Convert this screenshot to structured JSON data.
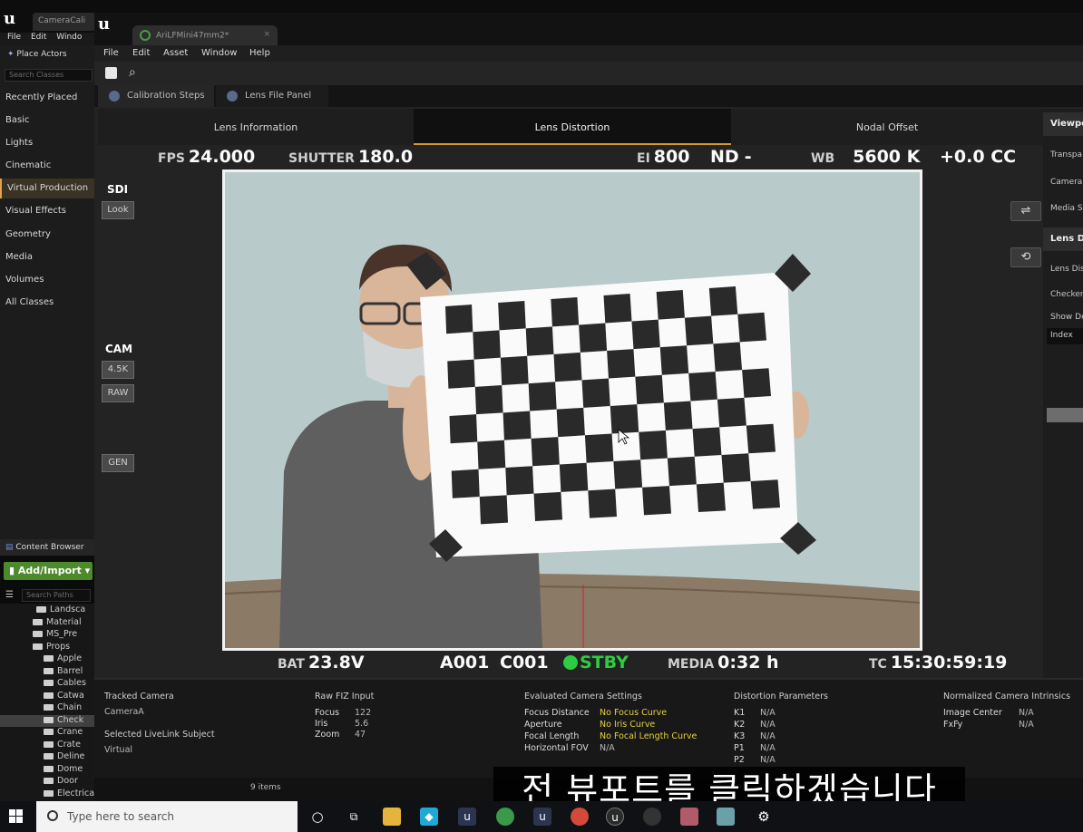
{
  "back_window": {
    "tab_title": "CameraCali",
    "menu": [
      "File",
      "Edit",
      "Windo"
    ],
    "place_actors": "Place Actors",
    "search_classes_placeholder": "Search Classes",
    "categories": [
      "Recently Placed",
      "Basic",
      "Lights",
      "Cinematic",
      "Virtual Production",
      "Visual Effects",
      "Geometry",
      "Media",
      "Volumes",
      "All Classes"
    ],
    "active_category": "Virtual Production",
    "content_browser": "Content Browser",
    "add_import": "Add/Import ▾",
    "search_paths_placeholder": "Search Paths",
    "folders": [
      "Landsca",
      "Material",
      "MS_Pre",
      "Props",
      "Apple",
      "Barrel",
      "Cables",
      "Catwa",
      "Chain",
      "Check",
      "Crane",
      "Crate",
      "Deline",
      "Dome",
      "Door",
      "ElectricalBox"
    ],
    "selected_folder": "Check",
    "items_count": "9 items"
  },
  "front_window": {
    "tab_title": "AriLFMini47mm2*",
    "menu": [
      "File",
      "Edit",
      "Asset",
      "Window",
      "Help"
    ],
    "subtabs": [
      "Calibration Steps",
      "Lens File Panel"
    ],
    "steps": [
      "Lens Information",
      "Lens Distortion",
      "Nodal Offset"
    ],
    "active_step": "Lens Distortion",
    "side_panel": {
      "viewport_head": "Viewpo",
      "items1": [
        "Transpa",
        "Camera",
        "Media S"
      ],
      "lens_head": "Lens Di",
      "items2": [
        "Lens Dis",
        "Checker",
        "Show De"
      ],
      "index_label": "Index"
    }
  },
  "camera_overlay": {
    "fps_label": "FPS",
    "fps_value": "24.000",
    "shutter_label": "SHUTTER",
    "shutter_value": "180.0",
    "ei_label": "EI",
    "ei_value": "800",
    "nd_label": "ND",
    "nd_value": "-",
    "wb_label": "WB",
    "wb_value": "5600 K",
    "cc_value": "+0.0 CC",
    "sdi_label": "SDI",
    "look_btn": "Look",
    "cam_label": "CAM",
    "res_btn": "4.5K",
    "raw_btn": "RAW",
    "gen_btn": "GEN",
    "bat_label": "BAT",
    "bat_value": "23.8V",
    "reel": "A001",
    "clip": "C001",
    "status": "STBY",
    "media_label": "MEDIA",
    "media_value": "0:32 h",
    "tc_label": "TC",
    "tc_value": "15:30:59:19",
    "status_color": "#2ecc40"
  },
  "info": {
    "tracked_camera_h": "Tracked Camera",
    "tracked_camera_v": "CameraA",
    "selected_subject_h": "Selected LiveLink Subject",
    "selected_subject_v": "Virtual",
    "raw_fiz_h": "Raw FIZ Input",
    "fiz": [
      {
        "k": "Focus",
        "v": "122"
      },
      {
        "k": "Iris",
        "v": "5.6"
      },
      {
        "k": "Zoom",
        "v": "47"
      }
    ],
    "evaluated_h": "Evaluated Camera Settings",
    "evaluated": [
      {
        "k": "Focus Distance",
        "v": "No Focus Curve"
      },
      {
        "k": "Aperture",
        "v": "No Iris Curve"
      },
      {
        "k": "Focal Length",
        "v": "No Focal Length Curve"
      },
      {
        "k": "Horizontal FOV",
        "v": "N/A"
      }
    ],
    "distortion_h": "Distortion Parameters",
    "distortion": [
      {
        "k": "K1",
        "v": "N/A"
      },
      {
        "k": "K2",
        "v": "N/A"
      },
      {
        "k": "K3",
        "v": "N/A"
      },
      {
        "k": "P1",
        "v": "N/A"
      },
      {
        "k": "P2",
        "v": "N/A"
      }
    ],
    "intrinsics_h": "Normalized Camera Intrinsics",
    "intrinsics": [
      {
        "k": "Image Center",
        "v": "N/A"
      },
      {
        "k": "FxFy",
        "v": "N/A"
      }
    ]
  },
  "subtitle": "전 뷰포트를 클릭하겠습니다",
  "taskbar": {
    "search_placeholder": "Type here to search"
  }
}
